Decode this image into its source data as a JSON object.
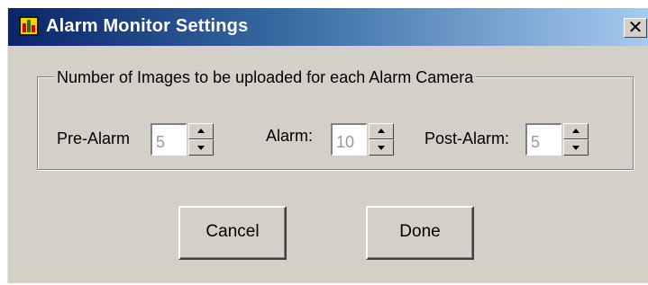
{
  "window": {
    "title": "Alarm Monitor Settings",
    "close_glyph": "✕"
  },
  "group": {
    "legend": "Number of Images to be uploaded for each Alarm Camera"
  },
  "fields": {
    "pre_alarm": {
      "label": "Pre-Alarm",
      "value": "5"
    },
    "alarm": {
      "label": "Alarm:",
      "value": "10"
    },
    "post_alarm": {
      "label": "Post-Alarm:",
      "value": "5"
    }
  },
  "buttons": {
    "cancel": "Cancel",
    "done": "Done"
  },
  "icons": {
    "app": "alarm-monitor-icon",
    "close": "close-icon",
    "spin_up": "arrow-up-icon",
    "spin_down": "arrow-down-icon"
  },
  "colors": {
    "titlebar_start": "#0a246a",
    "titlebar_end": "#a6caf0",
    "dialog_face": "#d4d0c8",
    "disabled_text": "#9a9a9a"
  }
}
